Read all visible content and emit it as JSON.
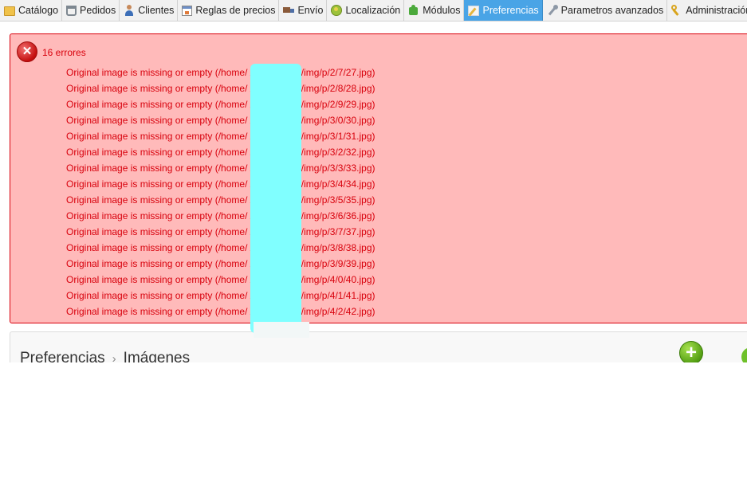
{
  "tabs": [
    {
      "label": "Catálogo",
      "icon": "folder-icon",
      "active": false
    },
    {
      "label": "Pedidos",
      "icon": "cart-icon",
      "active": false
    },
    {
      "label": "Clientes",
      "icon": "user-icon",
      "active": false
    },
    {
      "label": "Reglas de precios",
      "icon": "price-rules-icon",
      "active": false
    },
    {
      "label": "Envío",
      "icon": "truck-icon",
      "active": false
    },
    {
      "label": "Localización",
      "icon": "globe-icon",
      "active": false
    },
    {
      "label": "Módulos",
      "icon": "puzzle-icon",
      "active": false
    },
    {
      "label": "Preferencias",
      "icon": "preferences-icon",
      "active": true
    },
    {
      "label": "Parametros avanzados",
      "icon": "wrench-icon",
      "active": false
    },
    {
      "label": "Administración",
      "icon": "key-icon",
      "active": false
    }
  ],
  "errors": {
    "count_label": "16 errores",
    "icon": "error-icon",
    "items": [
      "Original image is missing or empty (/home/ /public_html/img/p/2/7/27.jpg)",
      "Original image is missing or empty (/home/ /public_html/img/p/2/8/28.jpg)",
      "Original image is missing or empty (/home/ /public_html/img/p/2/9/29.jpg)",
      "Original image is missing or empty (/home/ /public_html/img/p/3/0/30.jpg)",
      "Original image is missing or empty (/home/ /public_html/img/p/3/1/31.jpg)",
      "Original image is missing or empty (/home/ /public_html/img/p/3/2/32.jpg)",
      "Original image is missing or empty (/home/ /public_html/img/p/3/3/33.jpg)",
      "Original image is missing or empty (/home/ /public_html/img/p/3/4/34.jpg)",
      "Original image is missing or empty (/home/ /public_html/img/p/3/5/35.jpg)",
      "Original image is missing or empty (/home/ /public_html/img/p/3/6/36.jpg)",
      "Original image is missing or empty (/home/ /public_html/img/p/3/7/37.jpg)",
      "Original image is missing or empty (/home/ /public_html/img/p/3/8/38.jpg)",
      "Original image is missing or empty (/home/ /public_html/img/p/3/9/39.jpg)",
      "Original image is missing or empty (/home/ /public_html/img/p/4/0/40.jpg)",
      "Original image is missing or empty (/home/ /public_html/img/p/4/1/41.jpg)",
      "Original image is missing or empty (/home/ /public_html/img/p/4/2/42.jpg)"
    ]
  },
  "toolbar": {
    "breadcrumb": [
      "Preferencias",
      "Imágenes"
    ],
    "separator": "›",
    "add_label": "+"
  },
  "colors": {
    "active_tab": "#49a4e6",
    "error_bg": "#ffbaba",
    "error_text": "#d8000c",
    "redaction": "#80ffff"
  }
}
